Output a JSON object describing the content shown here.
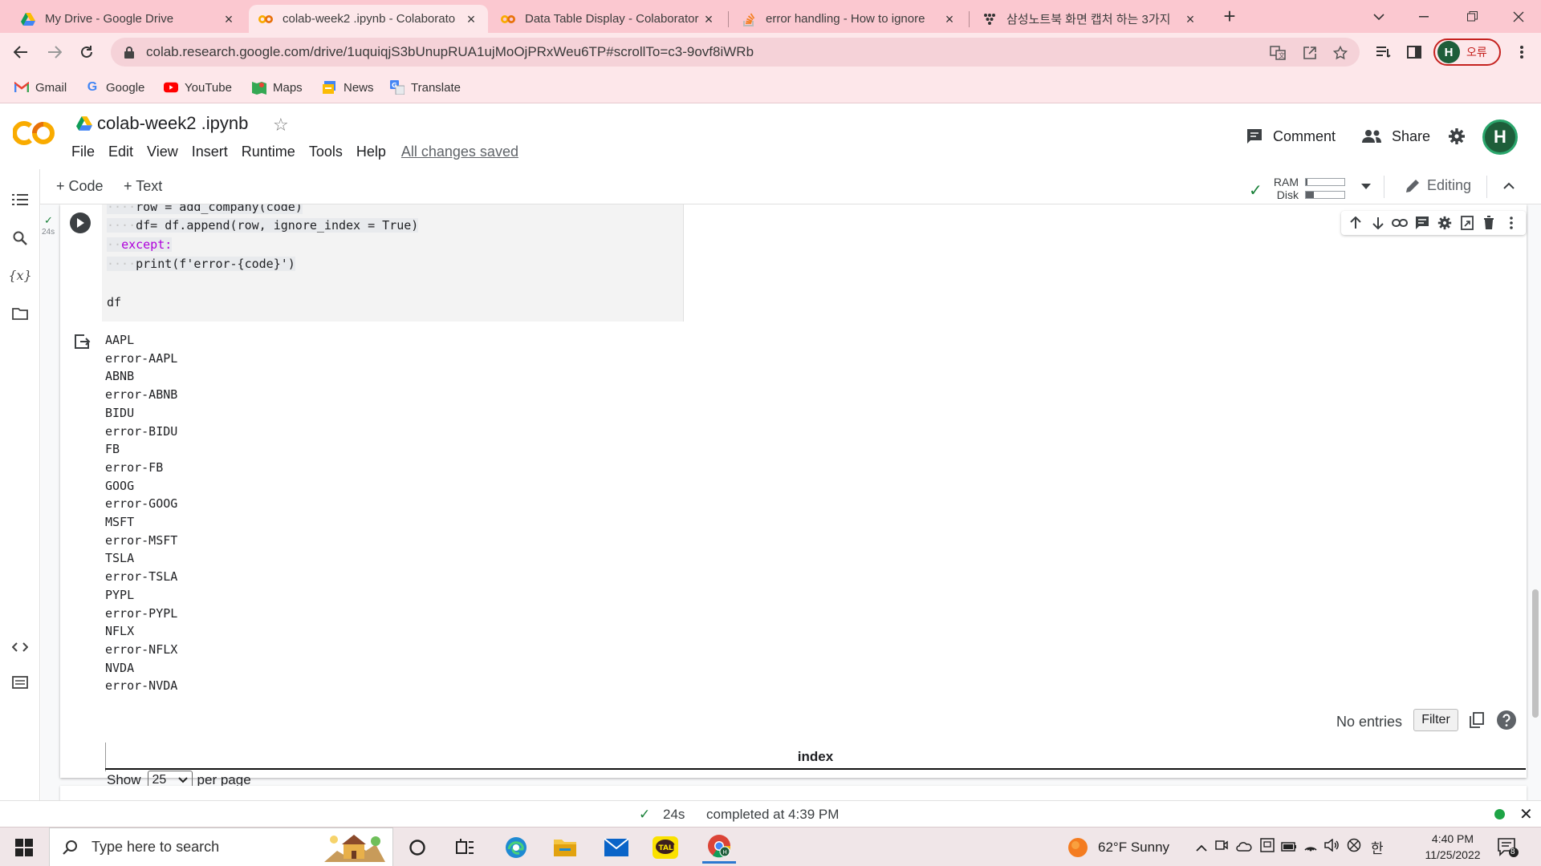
{
  "browser": {
    "tabs": [
      {
        "title": "My Drive - Google Drive",
        "icon": "google-drive-icon",
        "active": false
      },
      {
        "title": "colab-week2 .ipynb - Colaborato",
        "icon": "colab-icon",
        "active": true
      },
      {
        "title": "Data Table Display - Colaborator",
        "icon": "colab-icon",
        "active": false
      },
      {
        "title": "error handling - How to ignore",
        "icon": "stackoverflow-icon",
        "active": false
      },
      {
        "title": "삼성노트북 화면 캡처 하는 3가지",
        "icon": "dots-icon",
        "active": false
      }
    ],
    "url": "colab.research.google.com/drive/1uquiqjS3bUnupRUA1ujMoOjPRxWeu6TP#scrollTo=c3-9ovf8iWRb",
    "profile_initial": "H",
    "profile_status": "오류",
    "bookmarks": [
      {
        "label": "Gmail",
        "icon": "gmail-icon"
      },
      {
        "label": "Google",
        "icon": "google-icon"
      },
      {
        "label": "YouTube",
        "icon": "youtube-icon"
      },
      {
        "label": "Maps",
        "icon": "maps-icon"
      },
      {
        "label": "News",
        "icon": "news-icon"
      },
      {
        "label": "Translate",
        "icon": "translate-icon"
      }
    ]
  },
  "colab": {
    "notebook_title": "colab-week2 .ipynb",
    "menu": [
      "File",
      "Edit",
      "View",
      "Insert",
      "Runtime",
      "Tools",
      "Help"
    ],
    "save_status": "All changes saved",
    "comment_label": "Comment",
    "share_label": "Share",
    "user_initial": "H",
    "add_code_label": "+ Code",
    "add_text_label": "+ Text",
    "ram_label": "RAM",
    "disk_label": "Disk",
    "ram_usage": 0.05,
    "disk_usage": 0.2,
    "editing_label": "Editing",
    "accent_color": "#f9ab00"
  },
  "cell": {
    "exec_time": "24s",
    "code_lines": [
      {
        "indent": "····",
        "text": "row = add_company(code)"
      },
      {
        "indent": "····",
        "text": "df= df.append(row, ignore_index = True)"
      },
      {
        "indent": "··",
        "text": "except:"
      },
      {
        "indent": "····",
        "text": "print(f'error-{code}')"
      },
      {
        "indent": "",
        "text": ""
      },
      {
        "indent": "",
        "text": "df"
      }
    ],
    "output_lines": [
      "AAPL",
      "error-AAPL",
      "ABNB",
      "error-ABNB",
      "BIDU",
      "error-BIDU",
      "FB",
      "error-FB",
      "GOOG",
      "error-GOOG",
      "MSFT",
      "error-MSFT",
      "TSLA",
      "error-TSLA",
      "PYPL",
      "error-PYPL",
      "NFLX",
      "error-NFLX",
      "NVDA",
      "error-NVDA"
    ],
    "table": {
      "no_entries": "No entries",
      "filter_label": "Filter",
      "column_header": "index",
      "show_label": "Show",
      "per_page_value": "25",
      "per_page_label": "per page"
    }
  },
  "status": {
    "time": "24s",
    "message": "completed at 4:39 PM",
    "ok_color": "#1ea446"
  },
  "taskbar": {
    "search_placeholder": "Type here to search",
    "weather": "62°F  Sunny",
    "ime": "한",
    "time": "4:40 PM",
    "date": "11/25/2022",
    "notifications": "8"
  }
}
